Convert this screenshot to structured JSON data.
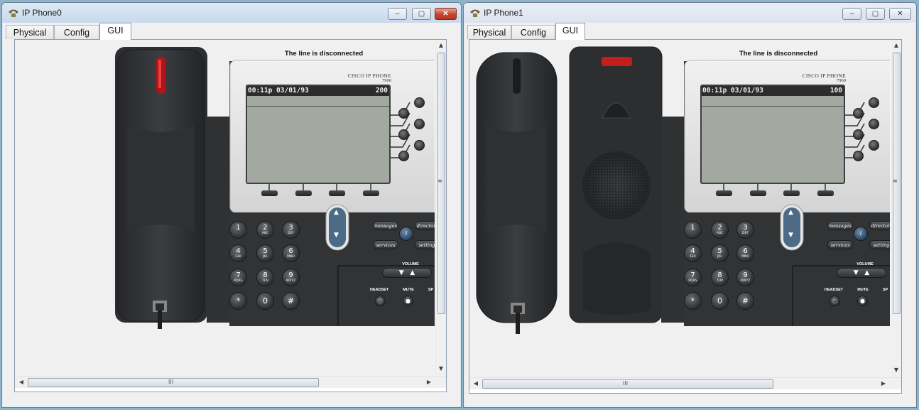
{
  "windows": [
    {
      "title": "IP Phone0",
      "controls": {
        "minimize": "–",
        "maximize": "▢",
        "close": "✕"
      },
      "tabs": [
        "Physical",
        "Config",
        "GUI"
      ],
      "active_tab": "GUI",
      "phone": {
        "status": "The line is disconnected",
        "brand": "CISCO IP PHONE",
        "model": "7960",
        "datetime": "00:11p 03/01/93",
        "extension": "200",
        "handset_state": "on-hook"
      }
    },
    {
      "title": "IP Phone1",
      "controls": {
        "minimize": "–",
        "maximize": "▢",
        "close": "✕"
      },
      "tabs": [
        "Physical",
        "Config",
        "GUI"
      ],
      "active_tab": "GUI",
      "phone": {
        "status": "The line is disconnected",
        "brand": "CISCO IP PHONE",
        "model": "7960",
        "datetime": "00:11p 03/01/93",
        "extension": "100",
        "handset_state": "off-hook"
      }
    }
  ],
  "keypad": [
    {
      "digit": "1",
      "letters": ""
    },
    {
      "digit": "2",
      "letters": "ABC"
    },
    {
      "digit": "3",
      "letters": "DEF"
    },
    {
      "digit": "4",
      "letters": "GHI"
    },
    {
      "digit": "5",
      "letters": "JKL"
    },
    {
      "digit": "6",
      "letters": "MNO"
    },
    {
      "digit": "7",
      "letters": "PQRS"
    },
    {
      "digit": "8",
      "letters": "TUV"
    },
    {
      "digit": "9",
      "letters": "WXYZ"
    },
    {
      "digit": "*",
      "letters": ""
    },
    {
      "digit": "0",
      "letters": ""
    },
    {
      "digit": "#",
      "letters": ""
    }
  ],
  "function_keys": {
    "messages": "messages",
    "directories": "directori",
    "services": "services",
    "settings": "setting",
    "info": "i",
    "volume": "VOLUME",
    "headset": "HEADSET",
    "mute": "MUTE",
    "speaker": "SP"
  },
  "scroll_grip": "III",
  "colors": {
    "window_chrome": "#dde9f6",
    "phone_body": "#2f3133",
    "lcd": "#a3a9a0",
    "message_led": "#c61c1c",
    "close_button": "#c7452c"
  }
}
